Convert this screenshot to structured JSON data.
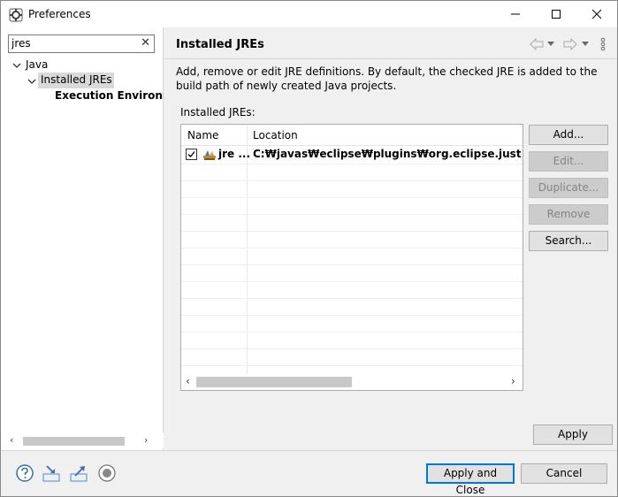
{
  "window": {
    "title": "Preferences",
    "minimize_icon": "minimize-icon",
    "maximize_icon": "maximize-icon",
    "close_icon": "close-icon"
  },
  "sidebar": {
    "filter_value": "jres",
    "clear_icon": "✕",
    "tree": [
      {
        "label": "Java",
        "level": 0,
        "expanded": true
      },
      {
        "label": "Installed JREs",
        "level": 1,
        "expanded": true,
        "selected": true
      },
      {
        "label": "Execution Environme",
        "level": 2
      }
    ]
  },
  "page": {
    "title": "Installed JREs",
    "description": "Add, remove or edit JRE definitions. By default, the checked JRE is added to the build path of newly created Java projects.",
    "installed_label": "Installed JREs:"
  },
  "table": {
    "columns": [
      "Name",
      "Location"
    ],
    "rows": [
      {
        "checked": true,
        "name": "jre ...",
        "location": "C:₩javas₩eclipse₩plugins₩org.eclipse.justj.openjdk.h"
      }
    ]
  },
  "buttons": {
    "add": "Add...",
    "edit": "Edit...",
    "duplicate": "Duplicate...",
    "remove": "Remove",
    "search": "Search...",
    "apply": "Apply",
    "apply_close": "Apply and Close",
    "cancel": "Cancel"
  },
  "footer_icons": [
    "help-icon",
    "import-icon",
    "export-icon",
    "record-icon"
  ],
  "colors": {
    "primary_border": "#0078d7",
    "selection": "#d9d9d9"
  }
}
